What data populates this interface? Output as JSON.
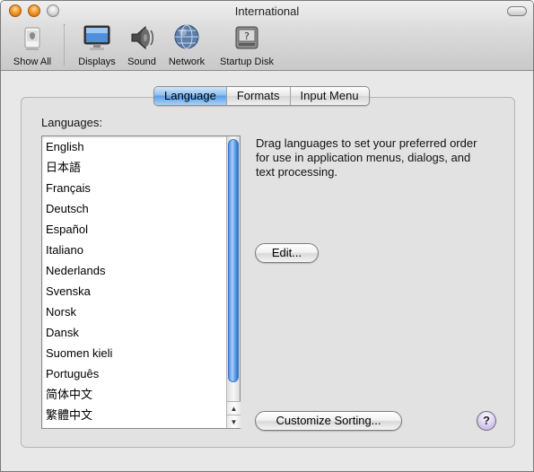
{
  "window": {
    "title": "International"
  },
  "toolbar": {
    "items": [
      {
        "label": "Show All",
        "icon": "show-all-icon"
      },
      {
        "label": "Displays",
        "icon": "displays-icon"
      },
      {
        "label": "Sound",
        "icon": "speaker-icon"
      },
      {
        "label": "Network",
        "icon": "network-globe-icon"
      },
      {
        "label": "Startup Disk",
        "icon": "hard-disk-icon"
      }
    ]
  },
  "tabs": [
    {
      "label": "Language",
      "active": true
    },
    {
      "label": "Formats",
      "active": false
    },
    {
      "label": "Input Menu",
      "active": false
    }
  ],
  "languages": {
    "label": "Languages:",
    "items": [
      "English",
      "日本語",
      "Français",
      "Deutsch",
      "Español",
      "Italiano",
      "Nederlands",
      "Svenska",
      "Norsk",
      "Dansk",
      "Suomen kieli",
      "Português",
      "简体中文",
      "繁體中文"
    ]
  },
  "instructions": "Drag languages to set your preferred order for use in application menus, dialogs, and text processing.",
  "buttons": {
    "edit": "Edit...",
    "customize_sorting": "Customize Sorting...",
    "help": "?"
  },
  "colors": {
    "selected_tab": "#5b9ee6",
    "scroll_thumb": "#4c8fe0",
    "close_button": "#f39a2a"
  }
}
